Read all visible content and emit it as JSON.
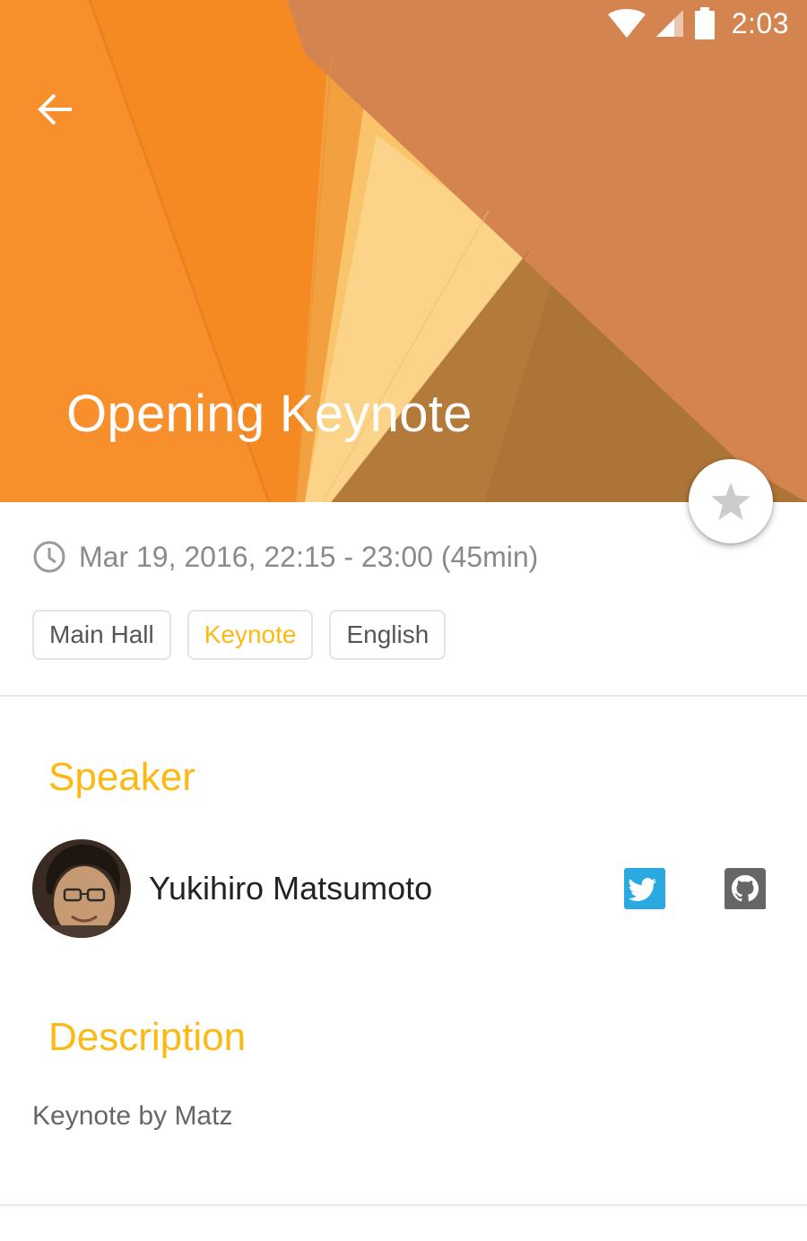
{
  "status_bar": {
    "time": "2:03",
    "icons": [
      "wifi-icon",
      "cell-signal-icon",
      "battery-icon"
    ]
  },
  "header": {
    "back_icon": "arrow-left-icon",
    "title": "Opening Keynote",
    "favorite_icon": "star-icon"
  },
  "session": {
    "clock_icon": "clock-icon",
    "time": "Mar 19, 2016, 22:15 - 23:00 (45min)",
    "tags": [
      {
        "label": "Main Hall"
      },
      {
        "label": "Keynote"
      },
      {
        "label": "English"
      }
    ]
  },
  "speaker_section": {
    "heading": "Speaker",
    "name": "Yukihiro Matsumoto",
    "links": [
      "twitter-icon",
      "github-icon"
    ]
  },
  "description_section": {
    "heading": "Description",
    "text": "Keynote by Matz"
  },
  "colors": {
    "accent": "#fdb913",
    "header_orange": "#f7902c",
    "header_brown": "#d4844f",
    "twitter_blue": "#29a9e0",
    "github_gray": "#666666"
  }
}
